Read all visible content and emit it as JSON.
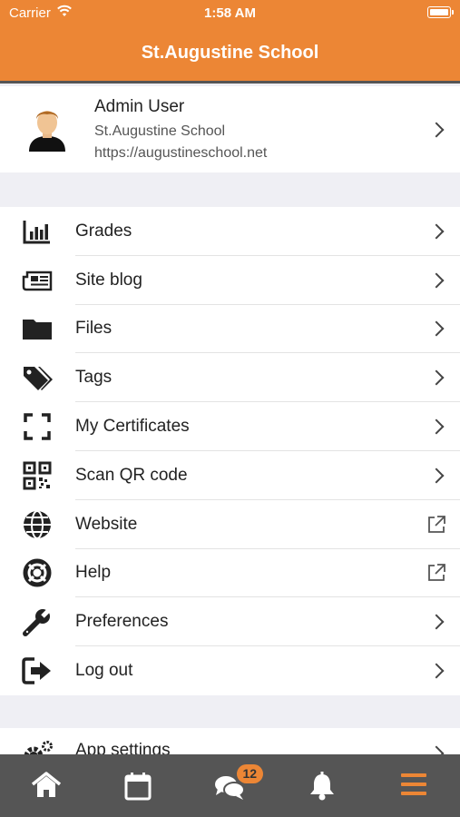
{
  "status_bar": {
    "carrier": "Carrier",
    "time": "1:58 AM"
  },
  "header": {
    "title": "St.Augustine School"
  },
  "profile": {
    "name": "Admin User",
    "site_name": "St.Augustine School",
    "url": "https://augustineschool.net"
  },
  "menu": [
    {
      "label": "Grades",
      "icon": "grades-chart-icon",
      "action": "chevron"
    },
    {
      "label": "Site blog",
      "icon": "newspaper-icon",
      "action": "chevron"
    },
    {
      "label": "Files",
      "icon": "folder-icon",
      "action": "chevron"
    },
    {
      "label": "Tags",
      "icon": "tags-icon",
      "action": "chevron"
    },
    {
      "label": "My Certificates",
      "icon": "certificate-frame-icon",
      "action": "chevron"
    },
    {
      "label": "Scan QR code",
      "icon": "qr-code-icon",
      "action": "chevron"
    },
    {
      "label": "Website",
      "icon": "globe-icon",
      "action": "external-link"
    },
    {
      "label": "Help",
      "icon": "lifebuoy-icon",
      "action": "external-link"
    },
    {
      "label": "Preferences",
      "icon": "wrench-icon",
      "action": "chevron"
    },
    {
      "label": "Log out",
      "icon": "logout-icon",
      "action": "chevron"
    }
  ],
  "menu2": [
    {
      "label": "App settings",
      "icon": "cogs-icon",
      "action": "chevron"
    }
  ],
  "tabbar": {
    "tabs": [
      {
        "name": "home",
        "icon": "home-icon"
      },
      {
        "name": "calendar",
        "icon": "calendar-icon"
      },
      {
        "name": "messages",
        "icon": "chat-bubbles-icon",
        "badge": "12"
      },
      {
        "name": "notifications",
        "icon": "bell-icon"
      },
      {
        "name": "more",
        "icon": "hamburger-menu-icon",
        "active": true
      }
    ]
  },
  "colors": {
    "accent": "#ec8635",
    "tabbar": "#555555",
    "background": "#efeff4"
  }
}
